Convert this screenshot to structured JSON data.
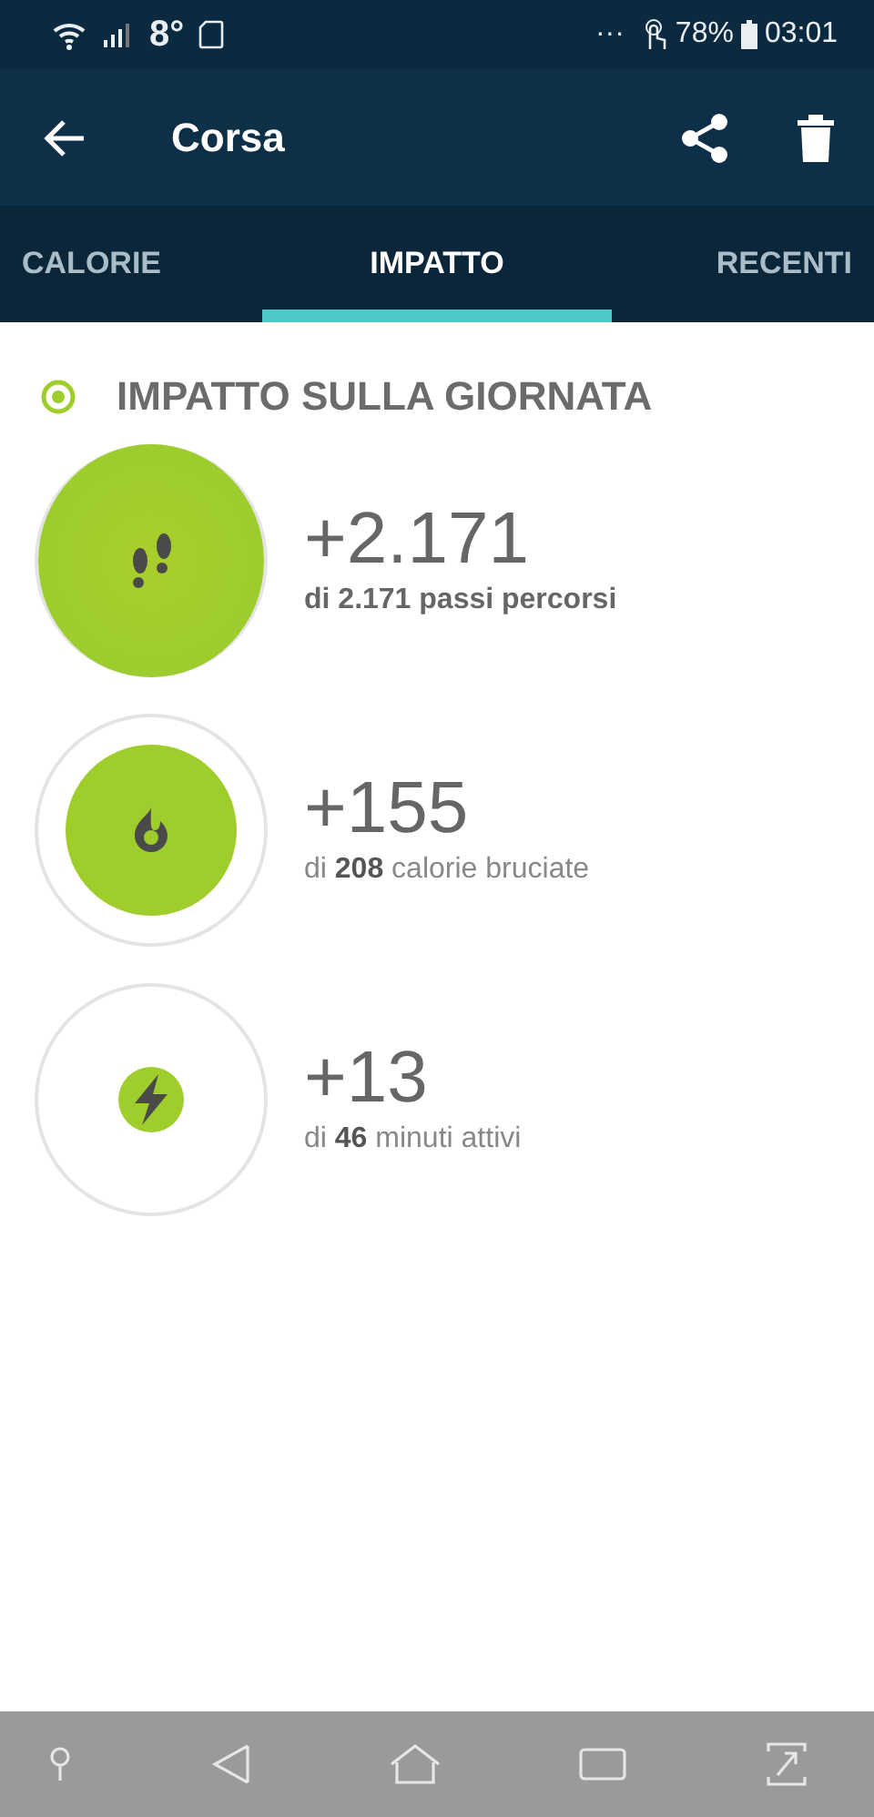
{
  "status_bar": {
    "temperature": "8°",
    "dots": "···",
    "battery": "78%",
    "time": "03:01"
  },
  "app_bar": {
    "title": "Corsa"
  },
  "tabs": [
    {
      "label": "CALORIE",
      "selected": false
    },
    {
      "label": "IMPATTO",
      "selected": true
    },
    {
      "label": "RECENTI",
      "selected": false
    }
  ],
  "section": {
    "title": "IMPATTO SULLA GIORNATA"
  },
  "metrics": [
    {
      "kind": "steps",
      "value": "+2.171",
      "caption": "di 2.171 passi percorsi",
      "goal_reached": true
    },
    {
      "kind": "calories",
      "value": "+155",
      "caption": "di **208** calorie bruciate",
      "goal_reached": false
    },
    {
      "kind": "minutes",
      "value": "+13",
      "caption": "di **46** minuti attivi",
      "goal_reached": false
    }
  ]
}
